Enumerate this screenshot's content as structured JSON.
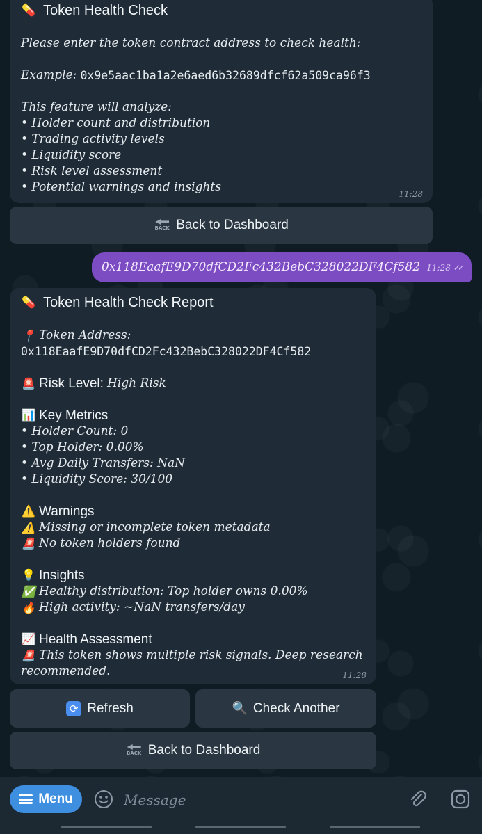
{
  "msg1": {
    "title": "Token Health Check",
    "prompt": "Please enter the token contract address to check health:",
    "example_label": "Example:",
    "example_address": "0x9e5aac1ba1a2e6aed6b32689dfcf62a509ca96f3",
    "feature_intro": "This feature will analyze:",
    "features": [
      "• Holder count and distribution",
      "• Trading activity levels",
      "• Liquidity score",
      "• Risk level assessment",
      "• Potential warnings and insights"
    ],
    "time": "11:28",
    "button_back": "Back to Dashboard"
  },
  "outgoing": {
    "text": "0x118EaafE9D70dfCD2Fc432BebC328022DF4Cf582",
    "time": "11:28"
  },
  "report": {
    "title": "Token Health Check Report",
    "token_address_label": "Token Address:",
    "token_address": "0x118EaafE9D70dfCD2Fc432BebC328022DF4Cf582",
    "risk_label": "Risk Level:",
    "risk_value": "High Risk",
    "metrics_title": "Key Metrics",
    "metrics": [
      "• Holder Count: 0",
      "• Top Holder: 0.00%",
      "• Avg Daily Transfers: NaN",
      "• Liquidity Score: 30/100"
    ],
    "warnings_title": "Warnings",
    "warnings": [
      "Missing or incomplete token metadata",
      "No token holders found"
    ],
    "insights_title": "Insights",
    "insights": [
      "Healthy distribution: Top holder owns 0.00%",
      "High activity: ~NaN transfers/day"
    ],
    "assessment_title": "Health Assessment",
    "assessment_line1": "This token shows multiple risk signals. Deep research",
    "assessment_line2": "recommended.",
    "time": "11:28"
  },
  "keyboard": {
    "refresh": "Refresh",
    "check_another": "Check Another",
    "back": "Back to Dashboard"
  },
  "composer": {
    "menu_label": "Menu",
    "placeholder": "Message"
  },
  "icon_label": "BACK"
}
